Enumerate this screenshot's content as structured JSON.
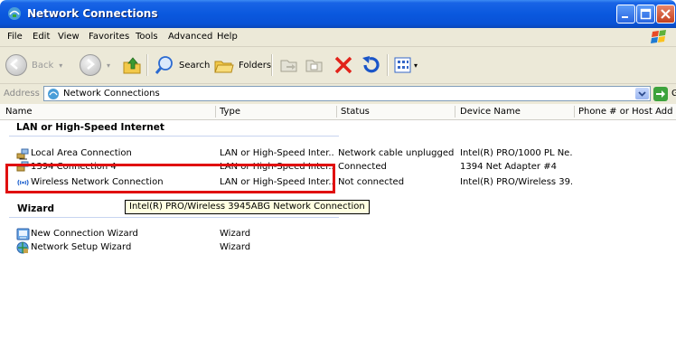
{
  "window": {
    "title": "Network Connections"
  },
  "menu": [
    "File",
    "Edit",
    "View",
    "Favorites",
    "Tools",
    "Advanced",
    "Help"
  ],
  "toolbar": {
    "back": "Back",
    "search": "Search",
    "folders": "Folders"
  },
  "address": {
    "label": "Address",
    "value": "Network Connections",
    "go": "Go"
  },
  "columns": [
    "Name",
    "Type",
    "Status",
    "Device Name",
    "Phone # or Host Address"
  ],
  "groups": {
    "lan": "LAN or High-Speed Internet",
    "wizard": "Wizard"
  },
  "rows": [
    {
      "name": "Local Area Connection",
      "type": "LAN or High-Speed Inter...",
      "status": "Network cable unplugged",
      "device": "Intel(R) PRO/1000 PL Ne...",
      "icon": "lan-connection-icon"
    },
    {
      "name": "1394 Connection 4",
      "type": "LAN or High-Speed Inter...",
      "status": "Connected",
      "device": "1394 Net Adapter #4",
      "icon": "lan-connection-icon"
    },
    {
      "name": "Wireless Network Connection",
      "type": "LAN or High-Speed Inter...",
      "status": "Not connected",
      "device": "Intel(R) PRO/Wireless 39...",
      "icon": "wireless-connection-icon"
    },
    {
      "name": "New Connection Wizard",
      "type": "Wizard",
      "status": "",
      "device": "",
      "icon": "new-connection-wizard-icon"
    },
    {
      "name": "Network Setup Wizard",
      "type": "Wizard",
      "status": "",
      "device": "",
      "icon": "network-setup-wizard-icon"
    }
  ],
  "tooltip": "Intel(R) PRO/Wireless 3945ABG Network Connection",
  "colors": {
    "titlebar": "#0a58de",
    "chrome": "#ece9d8",
    "highlight": "#e01010",
    "tooltip_bg": "#ffffe1"
  }
}
